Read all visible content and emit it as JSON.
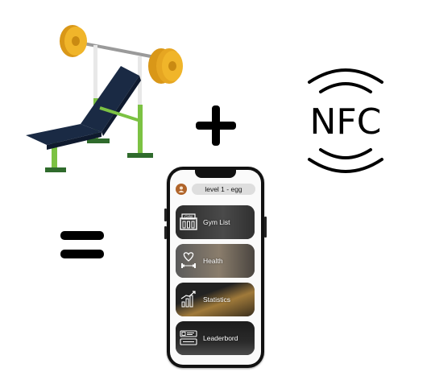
{
  "equation": {
    "plus_symbol": "plus",
    "equals_symbol": "equals"
  },
  "nfc": {
    "logo_text": "NFC"
  },
  "app": {
    "level_label": "level 1 - egg",
    "menu": [
      {
        "label": "Gym List",
        "icon": "gym-building-icon"
      },
      {
        "label": "Health",
        "icon": "heart-dumbbell-icon"
      },
      {
        "label": "Statistics",
        "icon": "bar-chart-icon"
      },
      {
        "label": "Leaderbord",
        "icon": "leaderboard-card-icon"
      }
    ]
  },
  "colors": {
    "bench_pad": "#1a2a44",
    "bench_frame": "#7cc243",
    "plate": "#e8a61f",
    "avatar": "#b0642a"
  }
}
